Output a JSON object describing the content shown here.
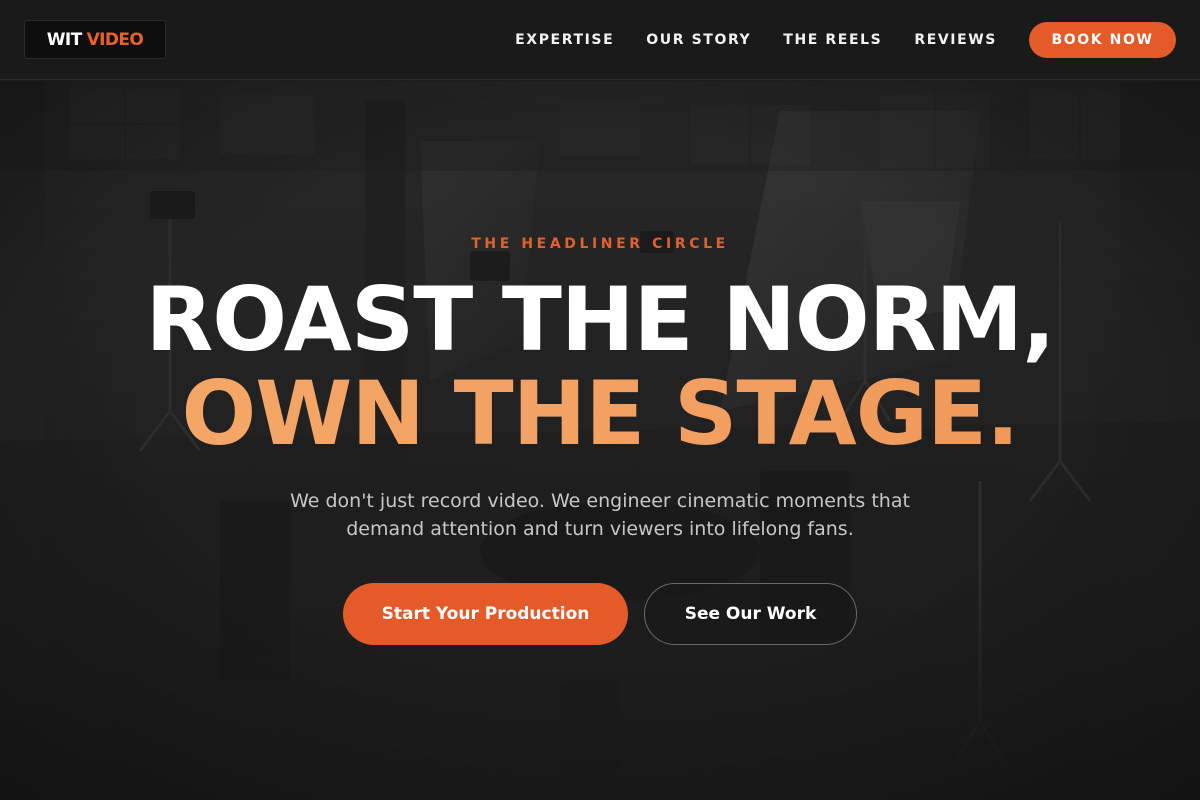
{
  "brand": {
    "word1": "WIT",
    "word2": "VIDEO",
    "accent": "#e45a28"
  },
  "nav": {
    "items": [
      {
        "label": "EXPERTISE"
      },
      {
        "label": "OUR STORY"
      },
      {
        "label": "THE REELS"
      },
      {
        "label": "REVIEWS"
      }
    ],
    "cta": "BOOK NOW"
  },
  "hero": {
    "eyebrow": "THE HEADLINER CIRCLE",
    "headline_line1": "ROAST THE NORM,",
    "headline_line2": "OWN THE STAGE.",
    "subtitle": "We don't just record video. We engineer cinematic moments that demand attention and turn viewers into lifelong fans.",
    "primary_cta": "Start Your Production",
    "secondary_cta": "See Our Work",
    "background_image": "dark film-studio warehouse with lighting rigs",
    "headline_accent": "#f2a163"
  }
}
